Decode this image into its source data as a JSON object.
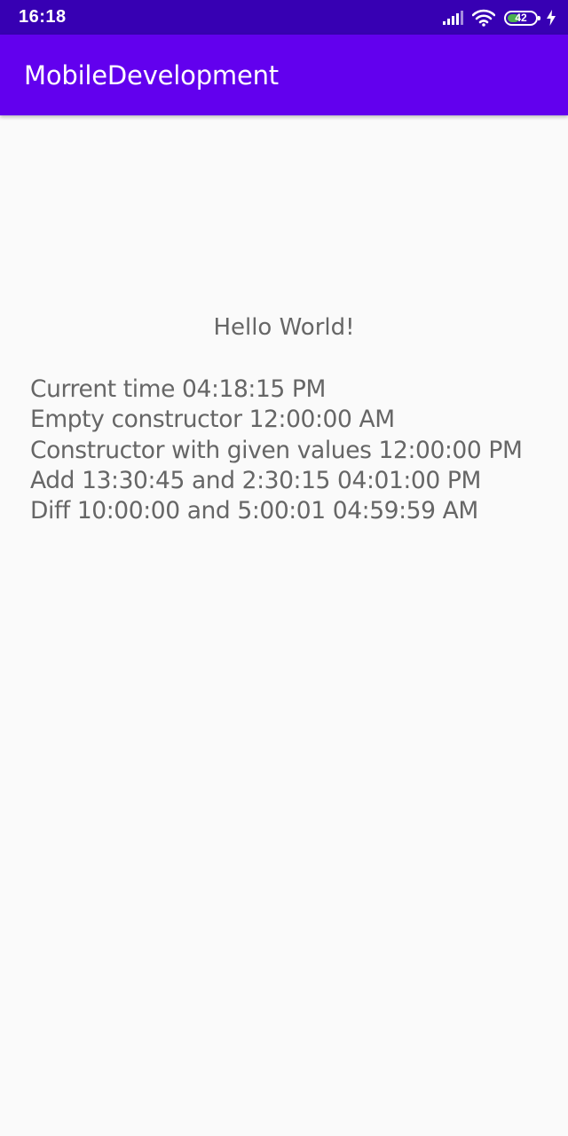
{
  "status_bar": {
    "time": "16:18",
    "battery_level": "42",
    "battery_fraction": 0.42,
    "icons": [
      "signal-icon",
      "wifi-icon",
      "battery-icon",
      "charging-icon"
    ]
  },
  "app_bar": {
    "title": "MobileDevelopment"
  },
  "main": {
    "hello": "Hello World!",
    "lines": [
      "Current time 04:18:15 PM",
      "Empty constructor 12:00:00 AM",
      "Constructor with given values 12:00:00 PM",
      "Add 13:30:45 and 2:30:15 04:01:00 PM",
      "Diff 10:00:00 and 5:00:01 04:59:59 AM"
    ]
  },
  "colors": {
    "status_bar": "#3700b3",
    "app_bar": "#6200ee",
    "background": "#fafafa",
    "text": "#666666",
    "battery_fill": "#4caf50"
  }
}
